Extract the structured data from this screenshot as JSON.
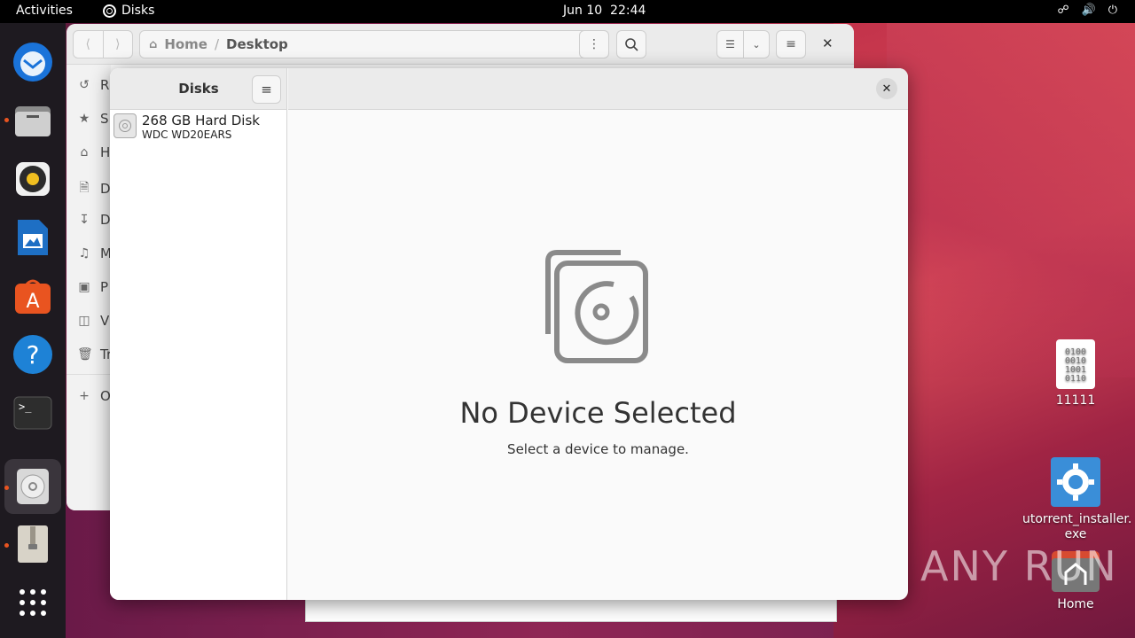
{
  "topbar": {
    "activities": "Activities",
    "app_name": "Disks",
    "date": "Jun 10",
    "time": "22:44"
  },
  "dock": {
    "items": [
      "thunderbird-icon",
      "files-icon",
      "rhythmbox-icon",
      "writer-icon",
      "app-center-icon",
      "help-icon",
      "terminal-icon",
      "disks-icon",
      "archive-icon",
      "app-grid-icon"
    ]
  },
  "files": {
    "path": [
      "Home",
      "Desktop"
    ],
    "sidebar_letters": [
      "R",
      "S",
      "H",
      "D",
      "D",
      "M",
      "P",
      "V",
      "Tr",
      "O"
    ]
  },
  "disks": {
    "title": "Disks",
    "device": {
      "name": "268 GB Hard Disk",
      "model": "WDC WD20EARS"
    },
    "empty_title": "No Device Selected",
    "empty_subtitle": "Select a device to manage."
  },
  "desktop": {
    "icons": [
      {
        "label": "11111"
      },
      {
        "label": "utorrent_installer.\nexe"
      },
      {
        "label": "Home"
      }
    ],
    "watermark": "ANY RUN"
  }
}
